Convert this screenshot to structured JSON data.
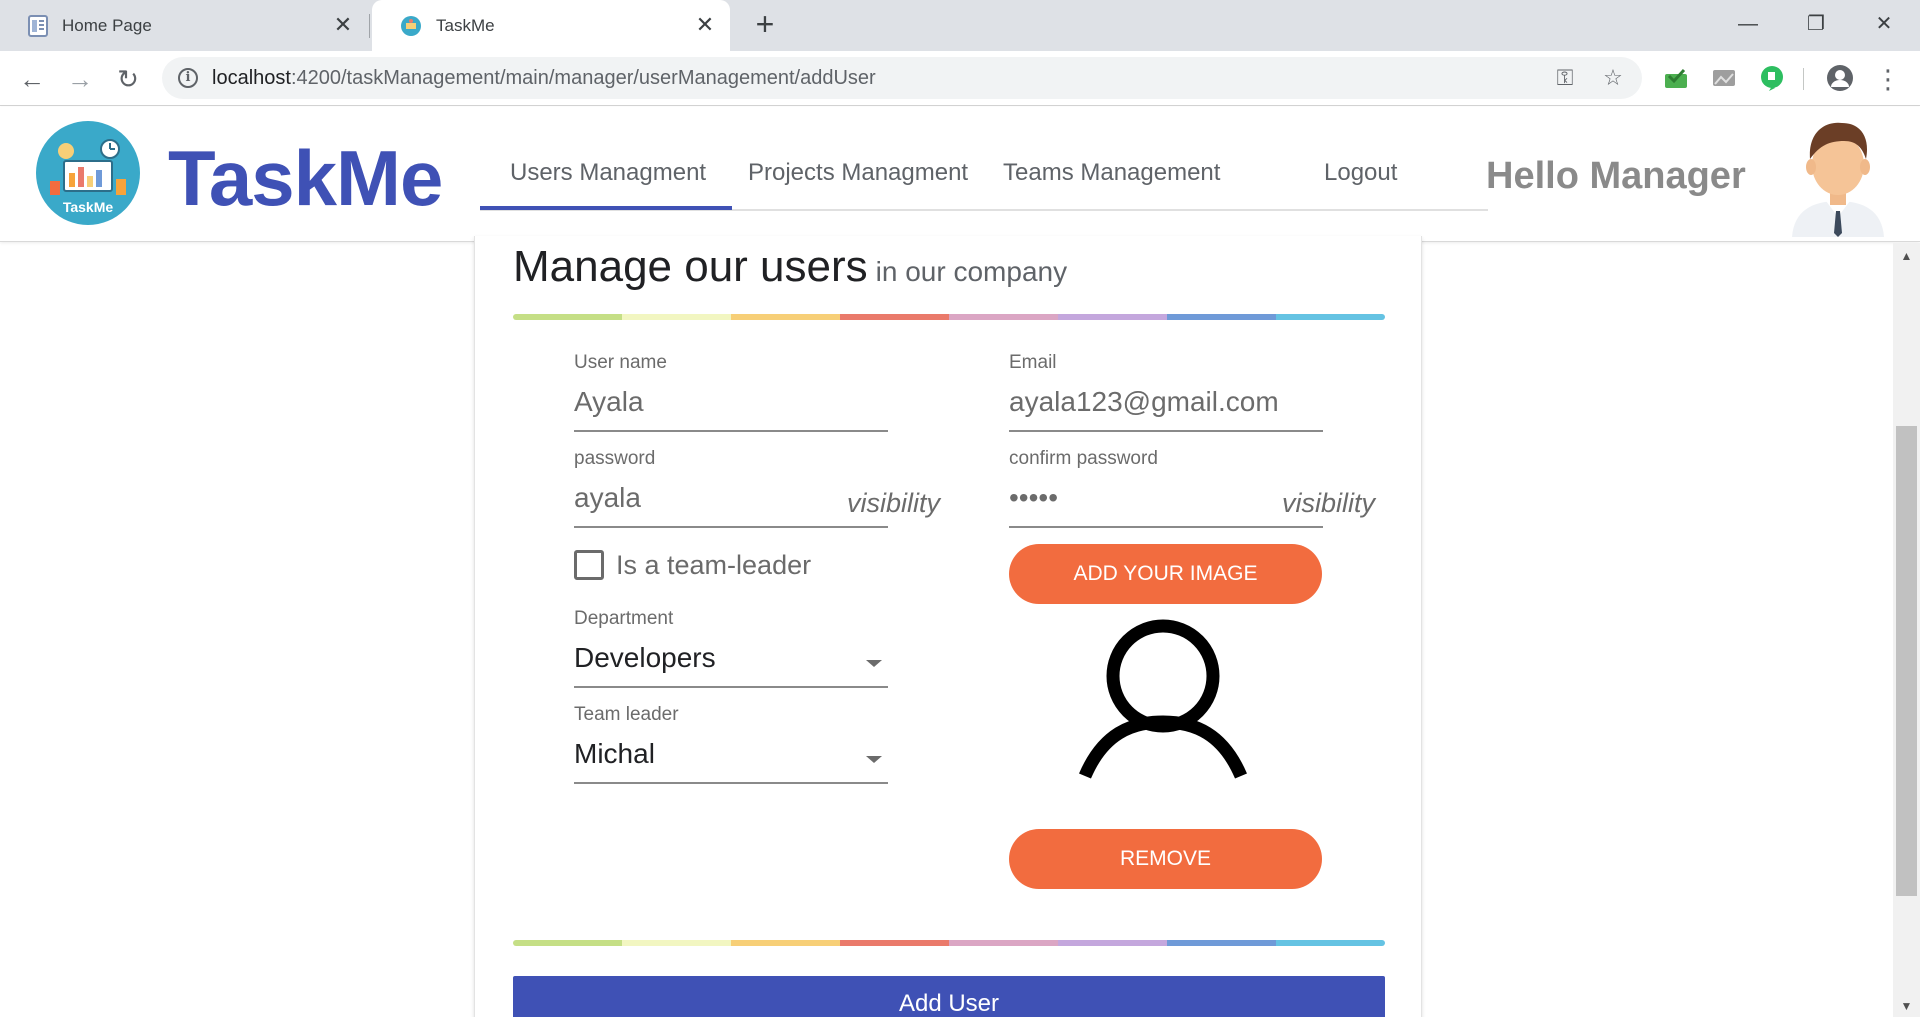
{
  "browser": {
    "tabs": [
      {
        "title": "Home Page",
        "close": "✕"
      },
      {
        "title": "TaskMe",
        "close": "✕"
      }
    ],
    "new_tab": "+",
    "window_controls": {
      "minimize": "—",
      "restore": "❐",
      "close": "✕"
    },
    "nav": {
      "back": "←",
      "forward": "→",
      "reload": "↻"
    },
    "url_host": "localhost",
    "url_path": ":4200/taskManagement/main/manager/userManagement/addUser",
    "omnibox_icons": {
      "info": "i",
      "key": "⚿",
      "star": "☆"
    },
    "menu": "⋮"
  },
  "header": {
    "logo_text": "TaskMe",
    "brand": "TaskMe",
    "nav_links": [
      "Users Managment",
      "Projects Managment",
      "Teams Management",
      "Logout"
    ],
    "active_link_index": 0,
    "greeting": "Hello Manager"
  },
  "form": {
    "title": "Manage our users",
    "subtitle": "in our company",
    "rainbow_colors": [
      "#c5df86",
      "#f2f6c1",
      "#f7cf77",
      "#ea7a6b",
      "#dba6c4",
      "#c4a7dd",
      "#6f9ad8",
      "#65c3e3"
    ],
    "username": {
      "label": "User name",
      "value": "Ayala"
    },
    "email": {
      "label": "Email",
      "value": "ayala123@gmail.com"
    },
    "password": {
      "label": "password",
      "value": "ayala",
      "toggle": "visibility"
    },
    "confirm_password": {
      "label": "confirm password",
      "value": "•••••",
      "toggle": "visibility"
    },
    "team_leader_checkbox": {
      "label": "Is a team-leader",
      "checked": false
    },
    "department": {
      "label": "Department",
      "value": "Developers"
    },
    "team_leader": {
      "label": "Team leader",
      "value": "Michal"
    },
    "add_image_button": "ADD YOUR IMAGE",
    "remove_button": "REMOVE",
    "submit_button": "Add User",
    "accent_color": "#f26c3f",
    "primary_color": "#3f51b5"
  },
  "scrollbar": {
    "up": "▲",
    "down": "▼"
  }
}
